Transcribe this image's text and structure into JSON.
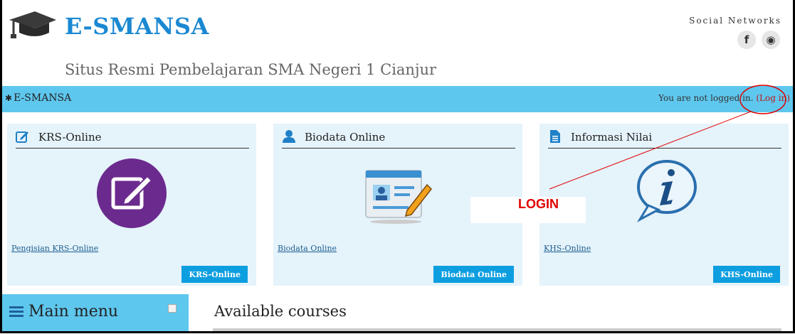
{
  "header": {
    "brand": "E-SMANSA",
    "tagline": "Situs Resmi Pembelajaran SMA Negeri 1 Cianjur",
    "social_label": "Social Networks",
    "social_icons": [
      "facebook-icon",
      "globe-icon"
    ],
    "facebook_glyph": "f",
    "globe_glyph": "◉"
  },
  "navbar": {
    "brand": "E-SMANSA",
    "gear_glyph": "✱",
    "login_status": "You are not logged in.",
    "login_link": "(Log in)"
  },
  "cards": [
    {
      "title": "KRS-Online",
      "icon": "edit-icon",
      "link": "Pengisian KRS-Online",
      "button": "KRS-Online"
    },
    {
      "title": "Biodata Online",
      "icon": "user-icon",
      "link": "Biodata Online",
      "button": "Biodata Online"
    },
    {
      "title": "Informasi Nilai",
      "icon": "document-icon",
      "link": "KHS-Online",
      "button": "KHS-Online"
    }
  ],
  "annotation": {
    "text": "LOGIN",
    "color": "#e00000"
  },
  "main_menu": {
    "title": "Main menu"
  },
  "courses": {
    "title": "Available courses"
  },
  "colors": {
    "brand": "#1a88d2",
    "navbar": "#5ec7ee",
    "card_bg": "#e5f3fb",
    "button": "#0d9ee0",
    "link": "#c01818"
  }
}
